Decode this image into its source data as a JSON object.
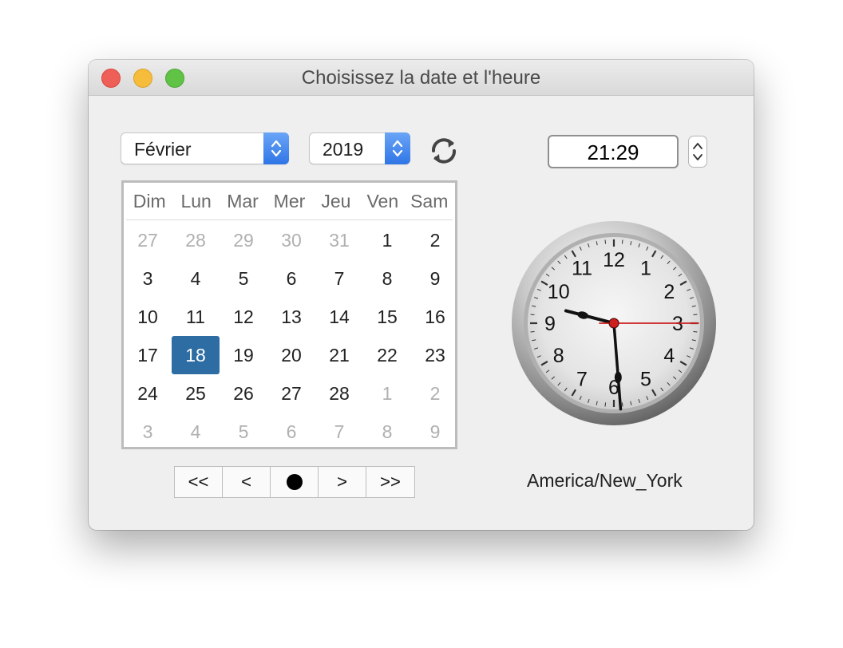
{
  "window": {
    "title": "Choisissez la date et l'heure"
  },
  "controls": {
    "month": "Février",
    "year": "2019",
    "refresh_icon": "refresh-icon",
    "time": "21:29",
    "timezone": "America/New_York"
  },
  "calendar": {
    "weekdays": [
      "Dim",
      "Lun",
      "Mar",
      "Mer",
      "Jeu",
      "Ven",
      "Sam"
    ],
    "weeks": [
      [
        {
          "d": "27",
          "o": true
        },
        {
          "d": "28",
          "o": true
        },
        {
          "d": "29",
          "o": true
        },
        {
          "d": "30",
          "o": true
        },
        {
          "d": "31",
          "o": true
        },
        {
          "d": "1",
          "o": false
        },
        {
          "d": "2",
          "o": false
        }
      ],
      [
        {
          "d": "3",
          "o": false
        },
        {
          "d": "4",
          "o": false
        },
        {
          "d": "5",
          "o": false
        },
        {
          "d": "6",
          "o": false
        },
        {
          "d": "7",
          "o": false
        },
        {
          "d": "8",
          "o": false
        },
        {
          "d": "9",
          "o": false
        }
      ],
      [
        {
          "d": "10",
          "o": false
        },
        {
          "d": "11",
          "o": false
        },
        {
          "d": "12",
          "o": false
        },
        {
          "d": "13",
          "o": false
        },
        {
          "d": "14",
          "o": false
        },
        {
          "d": "15",
          "o": false
        },
        {
          "d": "16",
          "o": false
        }
      ],
      [
        {
          "d": "17",
          "o": false
        },
        {
          "d": "18",
          "o": false,
          "sel": true
        },
        {
          "d": "19",
          "o": false
        },
        {
          "d": "20",
          "o": false
        },
        {
          "d": "21",
          "o": false
        },
        {
          "d": "22",
          "o": false
        },
        {
          "d": "23",
          "o": false
        }
      ],
      [
        {
          "d": "24",
          "o": false
        },
        {
          "d": "25",
          "o": false
        },
        {
          "d": "26",
          "o": false
        },
        {
          "d": "27",
          "o": false
        },
        {
          "d": "28",
          "o": false
        },
        {
          "d": "1",
          "o": true
        },
        {
          "d": "2",
          "o": true
        }
      ],
      [
        {
          "d": "3",
          "o": true
        },
        {
          "d": "4",
          "o": true
        },
        {
          "d": "5",
          "o": true
        },
        {
          "d": "6",
          "o": true
        },
        {
          "d": "7",
          "o": true
        },
        {
          "d": "8",
          "o": true
        },
        {
          "d": "9",
          "o": true
        }
      ]
    ]
  },
  "nav": {
    "first": "<<",
    "prev": "<",
    "today_icon": "dot-icon",
    "next": ">",
    "last": ">>"
  },
  "clock": {
    "hour": 21,
    "minute": 29,
    "second": 15,
    "numbers": [
      "12",
      "1",
      "2",
      "3",
      "4",
      "5",
      "6",
      "7",
      "8",
      "9",
      "10",
      "11"
    ]
  },
  "colors": {
    "selected_day": "#2e6da4",
    "select_arrow": "#2f75e6",
    "second_hand": "#cc2020"
  }
}
